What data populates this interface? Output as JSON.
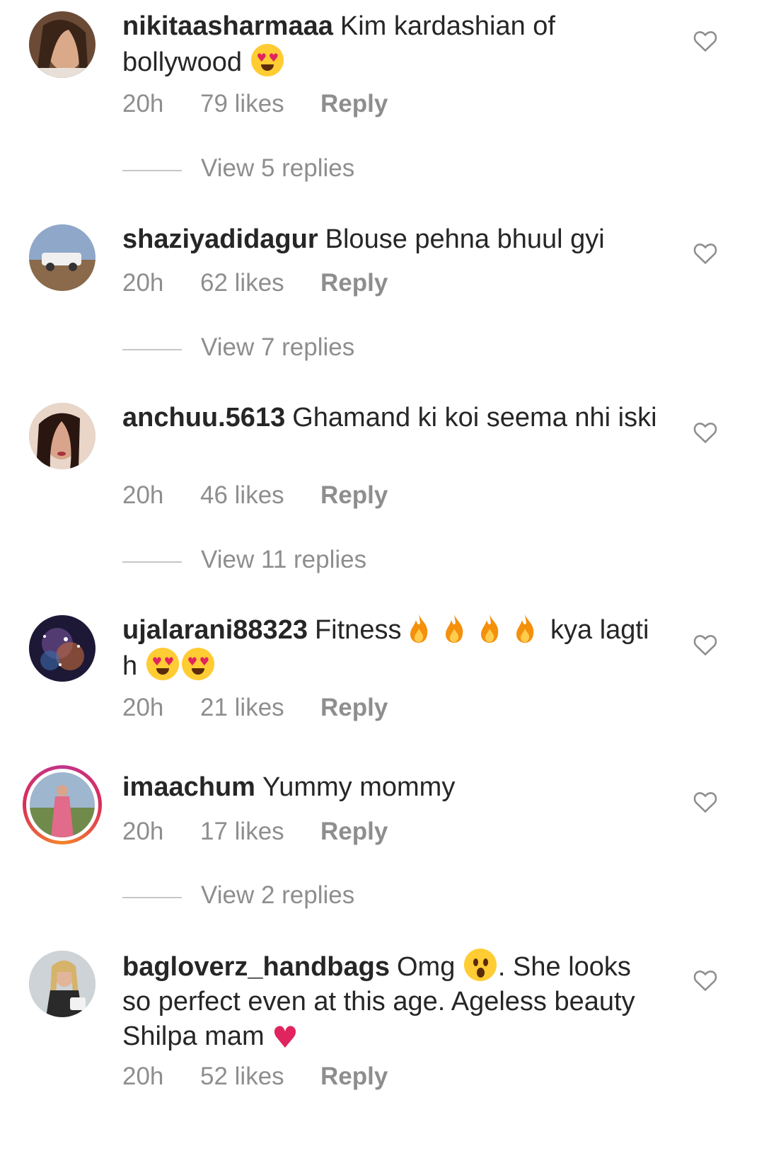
{
  "icons": {
    "like": "heart-outline-icon"
  },
  "comments": [
    {
      "username": "nikitaasharmaaa",
      "text": "Kim kardashian of bollywood",
      "time": "20h",
      "likes": "79 likes",
      "reply": "Reply",
      "view_replies": "View 5 replies"
    },
    {
      "username": "shaziyadidagur",
      "text": "Blouse pehna bhuul gyi",
      "time": "20h",
      "likes": "62 likes",
      "reply": "Reply",
      "view_replies": "View 7 replies"
    },
    {
      "username": "anchuu.5613",
      "text": "Ghamand ki koi seema nhi iski",
      "time": "20h",
      "likes": "46 likes",
      "reply": "Reply",
      "view_replies": "View 11 replies"
    },
    {
      "username": "ujalarani88323",
      "text_before": "Fitness",
      "text_mid": "kya lagti h",
      "time": "20h",
      "likes": "21 likes",
      "reply": "Reply"
    },
    {
      "username": "imaachum",
      "text": "Yummy mommy",
      "time": "20h",
      "likes": "17 likes",
      "reply": "Reply",
      "view_replies": "View 2 replies"
    },
    {
      "username": "bagloverz_handbags",
      "text_before": "Omg",
      "text_after": ". She looks so perfect even at this age. Ageless beauty Shilpa mam",
      "time": "20h",
      "likes": "52 likes",
      "reply": "Reply"
    }
  ]
}
